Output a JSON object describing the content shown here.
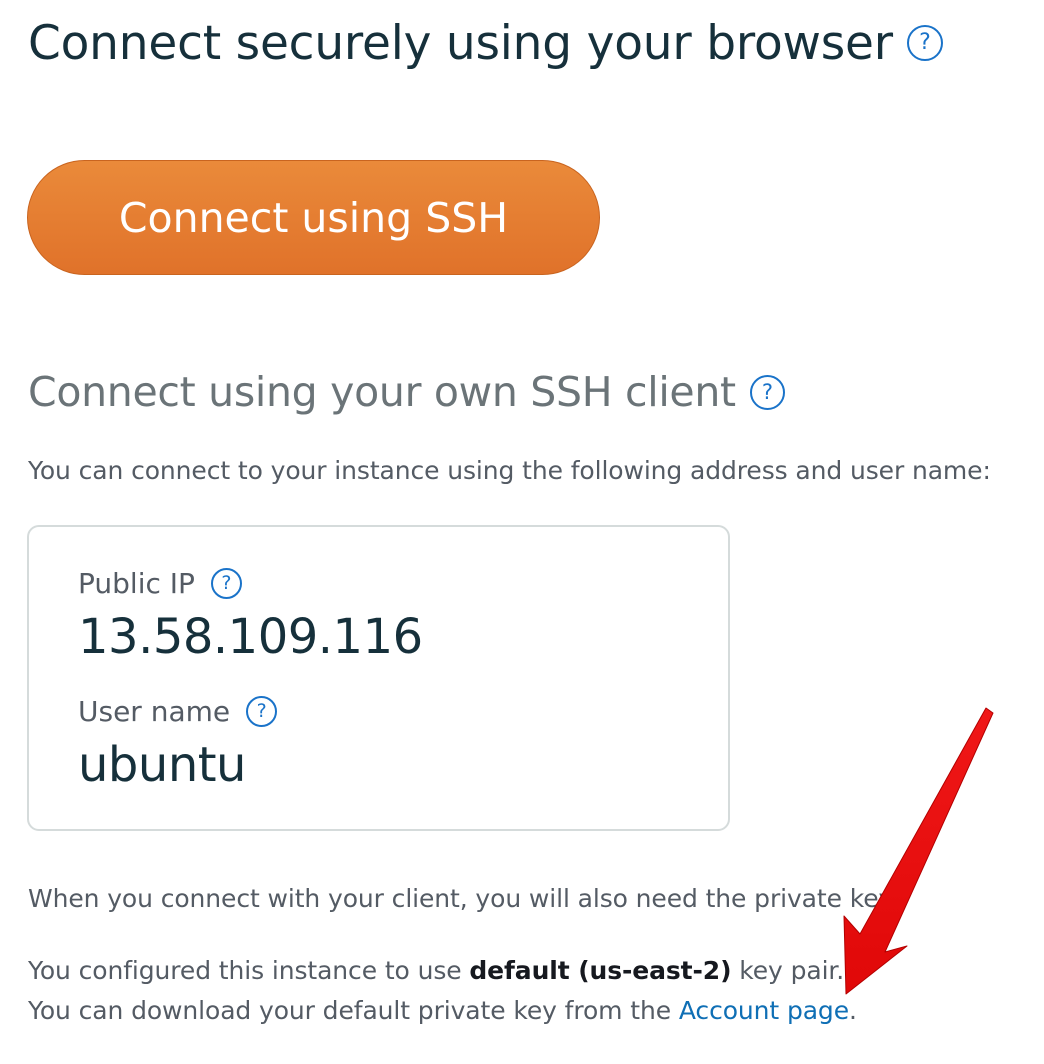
{
  "browser_section": {
    "title": "Connect securely using your browser",
    "help_glyph": "?",
    "connect_button_label": "Connect using SSH"
  },
  "client_section": {
    "title": "Connect using your own SSH client",
    "help_glyph": "?",
    "intro": "You can connect to your instance using the following address and user name:"
  },
  "info_card": {
    "public_ip_label": "Public IP",
    "public_ip_value": "13.58.109.116",
    "user_name_label": "User name",
    "user_name_value": "ubuntu",
    "help_glyph": "?"
  },
  "key_info": {
    "need_key_text": "When you connect with your client, you will also need the private key.",
    "configured_prefix": "You configured this instance to use ",
    "key_pair_name": "default (us-east-2)",
    "configured_suffix": " key pair.",
    "download_prefix": "You can download your default private key from the ",
    "account_link_label": "Account page",
    "download_suffix": "."
  },
  "colors": {
    "accent_orange": "#e47b2f",
    "link_blue": "#0f6fb5",
    "annotation_arrow": "#f20d0d"
  },
  "icons": [
    "help-icon",
    "annotation-arrow"
  ]
}
